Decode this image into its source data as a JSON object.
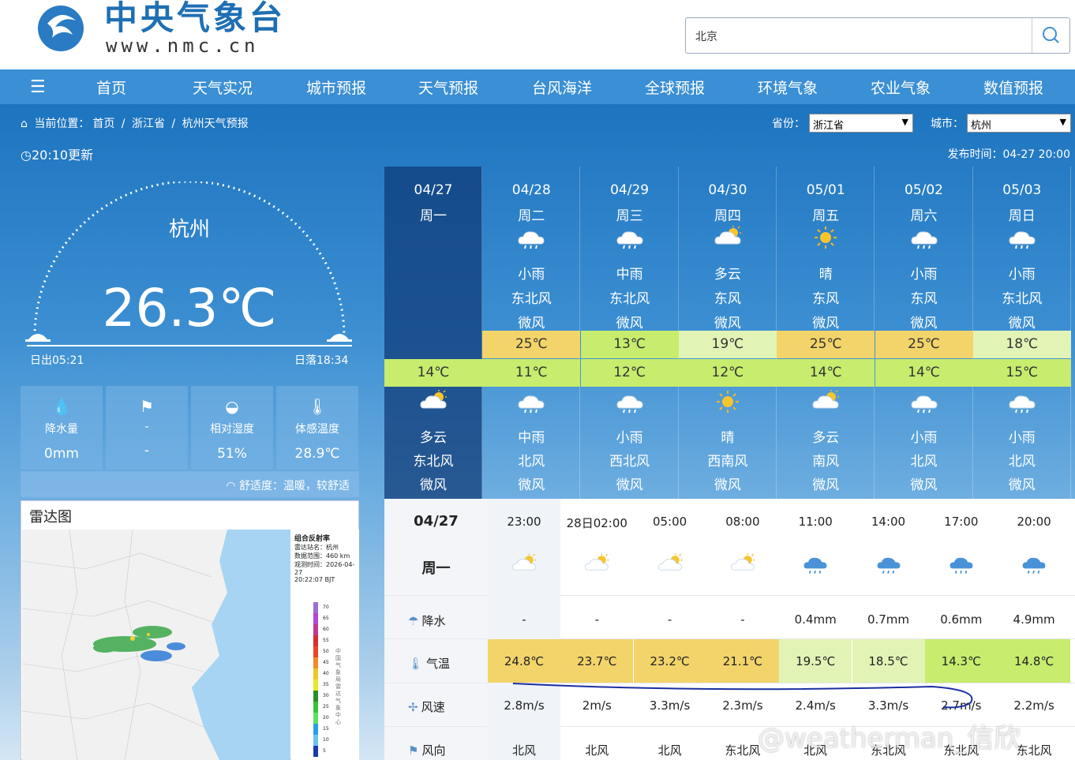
{
  "header": {
    "logo_title": "中央气象台",
    "logo_url": "www.nmc.cn",
    "search_value": "北京"
  },
  "nav": {
    "items": [
      "首页",
      "天气实况",
      "城市预报",
      "天气预报",
      "台风海洋",
      "全球预报",
      "环境气象",
      "农业气象",
      "数值预报"
    ]
  },
  "breadcrumb": {
    "prefix": "当前位置：",
    "items": [
      "首页",
      "/",
      "浙江省",
      "/",
      "杭州天气预报"
    ]
  },
  "selectors": {
    "province_label": "省份：",
    "province_value": "浙江省",
    "city_label": "城市：",
    "city_value": "杭州"
  },
  "update": {
    "updated": "20:10更新",
    "published": "发布时间：04-27 20:00"
  },
  "current": {
    "city": "杭州",
    "temp": "26.3℃",
    "sunrise": "日出05:21",
    "sunset": "日落18:34"
  },
  "stats": [
    {
      "icon": "raindrops-icon",
      "label": "降水量",
      "value": "0mm"
    },
    {
      "icon": "wind-vane-icon",
      "label": "-",
      "value": "-"
    },
    {
      "icon": "humidity-drop-icon",
      "label": "相对湿度",
      "value": "51%"
    },
    {
      "icon": "thermometer-icon",
      "label": "体感温度",
      "value": "28.9℃"
    }
  ],
  "comfort": "舒适度：温暖，较舒适",
  "radar": {
    "title": "雷达图",
    "side_title": "组合反射率",
    "side_lines": [
      "雷达站名：杭州",
      "数据范围：460 km",
      "观测时间：2026-04-27",
      "20:22:07 BJT"
    ],
    "vertical_text": "中国气象局雷达气象中心",
    "legend": [
      "70",
      "65",
      "60",
      "55",
      "50",
      "45",
      "40",
      "35",
      "30",
      "25",
      "20",
      "15",
      "10",
      "5"
    ]
  },
  "forecast": [
    {
      "date": "04/27",
      "week": "周一",
      "day_icon": "",
      "day_weather": "",
      "day_wind_dir": "",
      "day_wind": "",
      "high": "",
      "low": "14℃",
      "night_icon": "partly-cloudy-night-icon",
      "night_weather": "多云",
      "night_wind_dir": "东北风",
      "night_wind": "微风",
      "high_color": "",
      "low_color": "#c7ec6e"
    },
    {
      "date": "04/28",
      "week": "周二",
      "day_icon": "light-rain-icon",
      "day_weather": "小雨",
      "day_wind_dir": "东北风",
      "day_wind": "微风",
      "high": "25℃",
      "low": "11℃",
      "night_icon": "moderate-rain-icon",
      "night_weather": "中雨",
      "night_wind_dir": "北风",
      "night_wind": "微风",
      "high_color": "#f2d46a",
      "low_color": "#c7ec6e"
    },
    {
      "date": "04/29",
      "week": "周三",
      "day_icon": "moderate-rain-icon",
      "day_weather": "中雨",
      "day_wind_dir": "东北风",
      "day_wind": "微风",
      "high": "13℃",
      "low": "12℃",
      "night_icon": "light-rain-icon",
      "night_weather": "小雨",
      "night_wind_dir": "西北风",
      "night_wind": "微风",
      "high_color": "#c7ec6e",
      "low_color": "#c7ec6e"
    },
    {
      "date": "04/30",
      "week": "周四",
      "day_icon": "partly-cloudy-icon",
      "day_weather": "多云",
      "day_wind_dir": "东风",
      "day_wind": "微风",
      "high": "19℃",
      "low": "12℃",
      "night_icon": "sunny-icon",
      "night_weather": "晴",
      "night_wind_dir": "西南风",
      "night_wind": "微风",
      "high_color": "#e2f3b6",
      "low_color": "#c7ec6e"
    },
    {
      "date": "05/01",
      "week": "周五",
      "day_icon": "sunny-icon",
      "day_weather": "晴",
      "day_wind_dir": "东风",
      "day_wind": "微风",
      "high": "25℃",
      "low": "14℃",
      "night_icon": "partly-cloudy-icon",
      "night_weather": "多云",
      "night_wind_dir": "南风",
      "night_wind": "微风",
      "high_color": "#f2d46a",
      "low_color": "#c7ec6e"
    },
    {
      "date": "05/02",
      "week": "周六",
      "day_icon": "light-rain-icon",
      "day_weather": "小雨",
      "day_wind_dir": "东风",
      "day_wind": "微风",
      "high": "25℃",
      "low": "14℃",
      "night_icon": "light-rain-icon",
      "night_weather": "小雨",
      "night_wind_dir": "北风",
      "night_wind": "微风",
      "high_color": "#f2d46a",
      "low_color": "#c7ec6e"
    },
    {
      "date": "05/03",
      "week": "周日",
      "day_icon": "light-rain-icon",
      "day_weather": "小雨",
      "day_wind_dir": "东北风",
      "day_wind": "微风",
      "high": "18℃",
      "low": "15℃",
      "night_icon": "light-rain-icon",
      "night_weather": "小雨",
      "night_wind_dir": "北风",
      "night_wind": "微风",
      "high_color": "#e2f3b6",
      "low_color": "#c7ec6e"
    }
  ],
  "hourly": {
    "date": "04/27",
    "week": "周一",
    "row_labels": {
      "precip": "降水",
      "temp": "气温",
      "wind_speed": "风速",
      "wind_dir": "风向"
    },
    "slots": [
      {
        "time": "23:00",
        "icon": "partly-cloudy-icon",
        "precip": "-",
        "temp": "24.8℃",
        "wind_speed": "2.8m/s",
        "wind_dir": "北风",
        "temp_color": "#f2d46a"
      },
      {
        "time": "28日02:00",
        "icon": "partly-cloudy-icon",
        "precip": "-",
        "temp": "23.7℃",
        "wind_speed": "2m/s",
        "wind_dir": "北风",
        "temp_color": "#f2d46a"
      },
      {
        "time": "05:00",
        "icon": "partly-cloudy-icon",
        "precip": "-",
        "temp": "23.2℃",
        "wind_speed": "3.3m/s",
        "wind_dir": "北风",
        "temp_color": "#f2d46a"
      },
      {
        "time": "08:00",
        "icon": "partly-cloudy-icon",
        "precip": "-",
        "temp": "21.1℃",
        "wind_speed": "2.3m/s",
        "wind_dir": "东北风",
        "temp_color": "#f2d46a"
      },
      {
        "time": "11:00",
        "icon": "rain-icon",
        "precip": "0.4mm",
        "temp": "19.5℃",
        "wind_speed": "2.4m/s",
        "wind_dir": "北风",
        "temp_color": "#e2f3b6"
      },
      {
        "time": "14:00",
        "icon": "rain-icon",
        "precip": "0.7mm",
        "temp": "18.5℃",
        "wind_speed": "3.3m/s",
        "wind_dir": "东北风",
        "temp_color": "#e2f3b6"
      },
      {
        "time": "17:00",
        "icon": "rain-icon",
        "precip": "0.6mm",
        "temp": "14.3℃",
        "wind_speed": "2.7m/s",
        "wind_dir": "东北风",
        "temp_color": "#c7ec6e"
      },
      {
        "time": "20:00",
        "icon": "rain-icon",
        "precip": "4.9mm",
        "temp": "14.8℃",
        "wind_speed": "2.2m/s",
        "wind_dir": "东北风",
        "temp_color": "#c7ec6e"
      }
    ]
  },
  "watermark": "@weatherman_信欣"
}
